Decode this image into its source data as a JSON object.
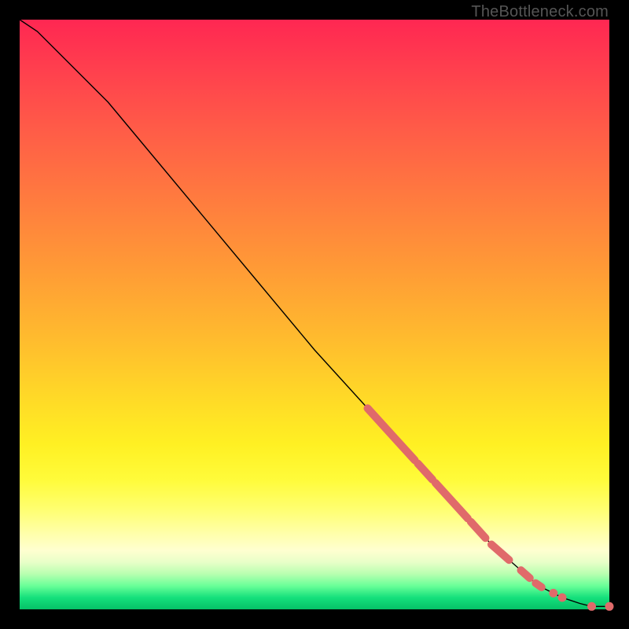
{
  "watermark": "TheBottleneck.com",
  "chart_data": {
    "type": "line",
    "title": "",
    "xlabel": "",
    "ylabel": "",
    "xlim": [
      0,
      100
    ],
    "ylim": [
      0,
      100
    ],
    "grid": false,
    "legend": false,
    "series": [
      {
        "name": "curve",
        "x": [
          0,
          3,
          6,
          10,
          15,
          20,
          30,
          40,
          50,
          60,
          70,
          80,
          88,
          92,
          95,
          97,
          100
        ],
        "y": [
          100,
          98,
          95,
          91,
          86,
          80,
          68,
          56,
          44,
          33,
          22,
          11,
          4,
          2,
          1,
          0.5,
          0.5
        ]
      }
    ],
    "highlighted_segments_x_ranges": [
      [
        59,
        67
      ],
      [
        67.5,
        70
      ],
      [
        70.5,
        76
      ],
      [
        76.5,
        79
      ],
      [
        80,
        83
      ],
      [
        85,
        86.5
      ],
      [
        87.5,
        88.5
      ]
    ],
    "highlighted_points_x": [
      90.5,
      92,
      97,
      100
    ],
    "colors": {
      "curve": "#000000",
      "highlight": "#e06a6a",
      "gradient_top": "#ff2752",
      "gradient_bottom": "#06c167"
    }
  }
}
